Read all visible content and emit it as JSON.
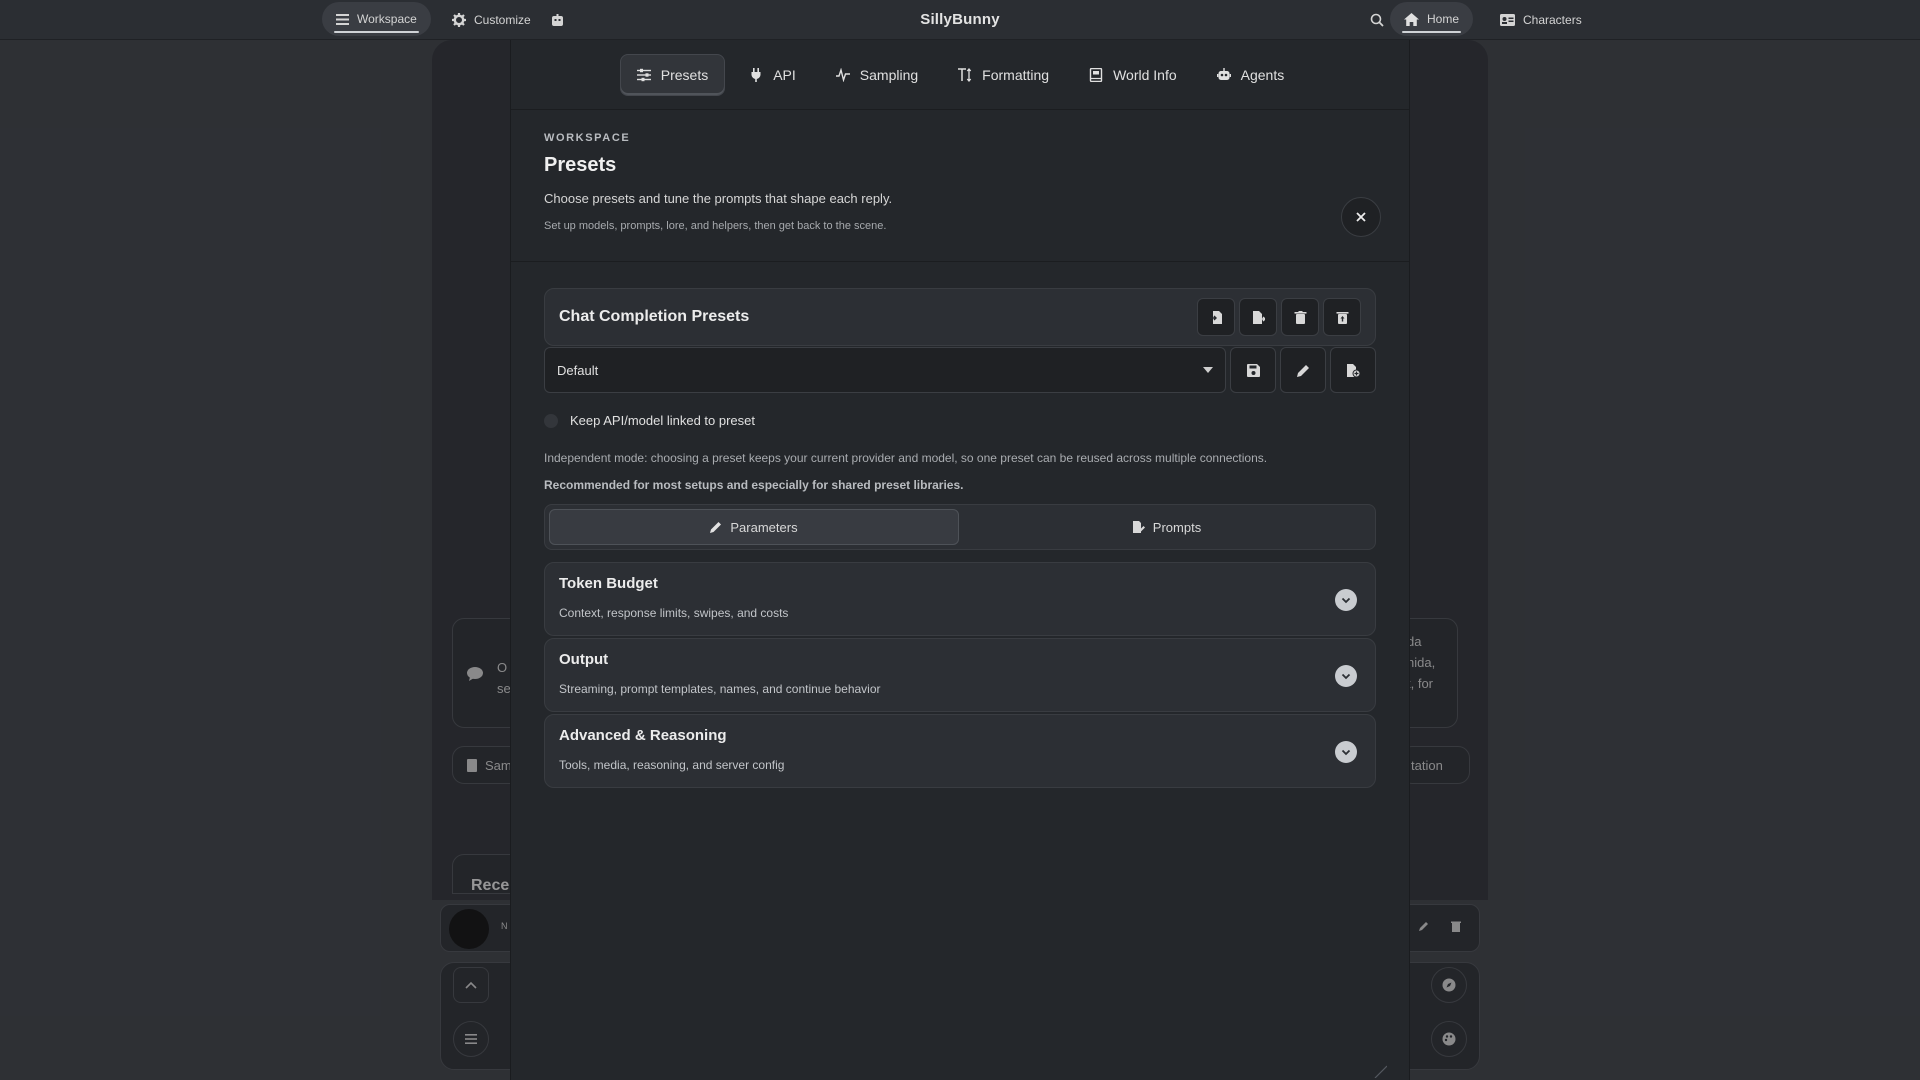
{
  "topbar": {
    "workspace_label": "Workspace",
    "customize_label": "Customize",
    "brand": "SillyBunny",
    "home_label": "Home",
    "characters_label": "Characters"
  },
  "background": {
    "left_card_text": "O\nse",
    "right_card_lines": [
      "da",
      "hida,",
      "t, for"
    ],
    "left_btn": "Sam",
    "right_btn": "tation",
    "recent_label": "Recer",
    "avatar_name": "N"
  },
  "modal": {
    "tabs": [
      {
        "label": "Presets",
        "icon": "sliders-icon"
      },
      {
        "label": "API",
        "icon": "plug-icon"
      },
      {
        "label": "Sampling",
        "icon": "wave-icon"
      },
      {
        "label": "Formatting",
        "icon": "text-height-icon"
      },
      {
        "label": "World Info",
        "icon": "book-icon"
      },
      {
        "label": "Agents",
        "icon": "robot-icon"
      }
    ],
    "eyebrow": "WORKSPACE",
    "title": "Presets",
    "subtitle": "Choose presets and tune the prompts that shape each reply.",
    "subtitle2": "Set up models, prompts, lore, and helpers, then get back to the scene.",
    "close_label": "×"
  },
  "presets": {
    "card_title": "Chat Completion Presets",
    "selected": "Default",
    "link_toggle_label": "Keep API/model linked to preset",
    "independent_note": "Independent mode: choosing a preset keeps your current provider and model, so one preset can be reused across multiple connections.",
    "recommended_note": "Recommended for most setups and especially for shared preset libraries.",
    "segments": [
      "Parameters",
      "Prompts"
    ],
    "active_segment": "Parameters"
  },
  "sections": [
    {
      "title": "Token Budget",
      "desc": "Context, response limits, swipes, and costs"
    },
    {
      "title": "Output",
      "desc": "Streaming, prompt templates, names, and continue behavior"
    },
    {
      "title": "Advanced & Reasoning",
      "desc": "Tools, media, reasoning, and server config"
    }
  ]
}
